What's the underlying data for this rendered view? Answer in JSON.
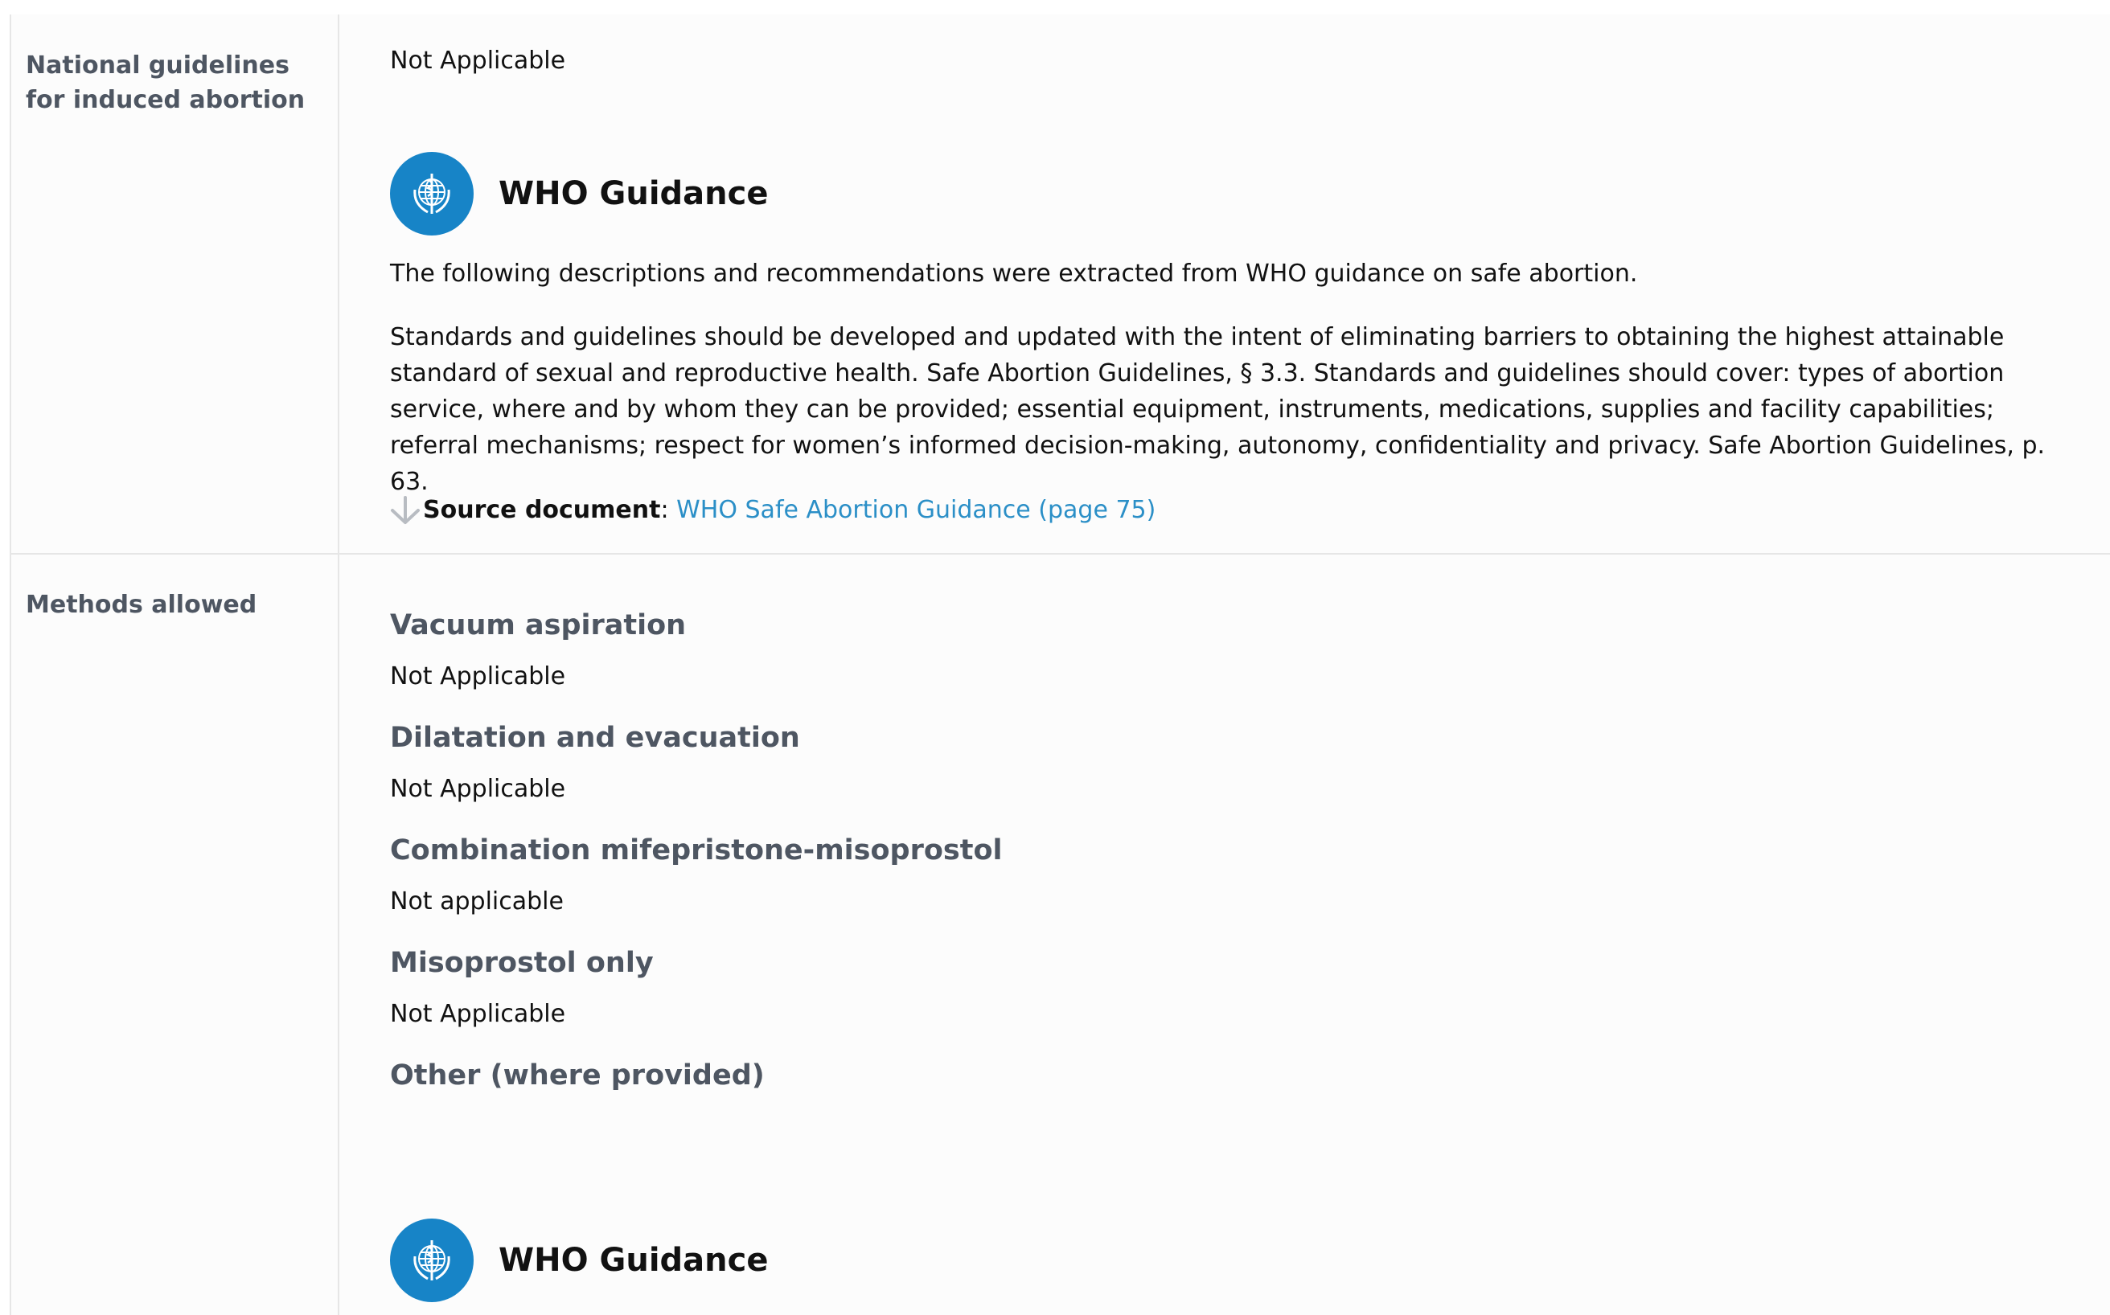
{
  "national_guidelines": {
    "label": "National guidelines for induced abortion",
    "value": "Not Applicable",
    "who_guidance": {
      "title": "WHO Guidance",
      "intro": "The following descriptions and recommendations were extracted from WHO guidance on safe abortion.",
      "body": "Standards and guidelines should be developed and updated with the intent of eliminating barriers to obtaining the highest attainable standard of sexual and reproductive health. Safe Abortion Guidelines, § 3.3. Standards and guidelines should cover: types of abortion service, where and by whom they can be provided; essential equipment, instruments, medications, supplies and facility capabilities; referral mechanisms; respect for women’s informed decision-making, autonomy, confidentiality and privacy. Safe Abortion Guidelines, p. 63.",
      "source_label": "Source document",
      "source_separator": ":",
      "source_link": "WHO Safe Abortion Guidance (page 75)"
    }
  },
  "methods_allowed": {
    "label": "Methods allowed",
    "methods": [
      {
        "title": "Vacuum aspiration",
        "value": "Not Applicable"
      },
      {
        "title": "Dilatation and evacuation",
        "value": "Not Applicable"
      },
      {
        "title": "Combination mifepristone-misoprostol",
        "value": "Not applicable"
      },
      {
        "title": "Misoprostol only",
        "value": "Not Applicable"
      },
      {
        "title": "Other (where provided)",
        "value": ""
      }
    ],
    "who_guidance": {
      "title": "WHO Guidance"
    }
  },
  "colors": {
    "who_blue": "#1784c7",
    "link_blue": "#2b8fc7",
    "label_gray": "#4e5662"
  },
  "icons": [
    "who-emblem-icon",
    "arrow-down-icon"
  ]
}
